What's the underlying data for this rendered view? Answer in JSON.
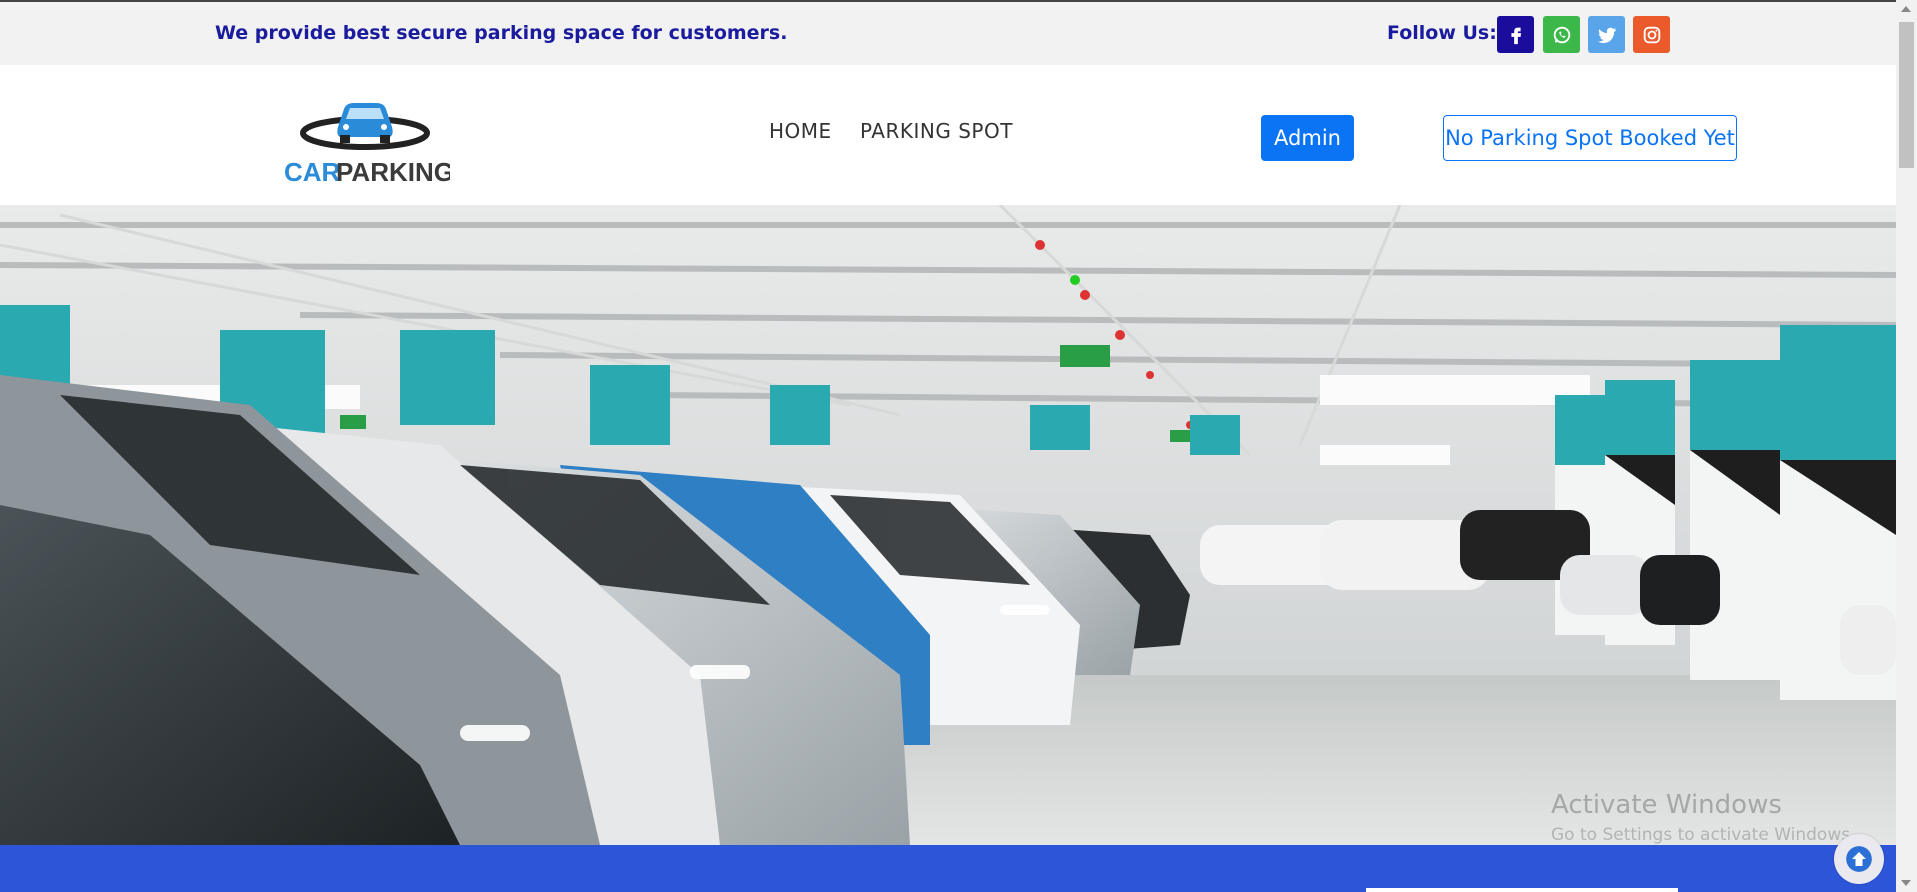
{
  "topbar": {
    "tagline": "We provide best secure parking space for customers.",
    "follow_label": "Follow Us:",
    "social": [
      {
        "icon": "facebook-icon",
        "color": "#1a0d9c"
      },
      {
        "icon": "whatsapp-icon",
        "color": "#3cb84a"
      },
      {
        "icon": "twitter-icon",
        "color": "#5aa5ea"
      },
      {
        "icon": "instagram-icon",
        "color": "#ea5a2a"
      }
    ]
  },
  "logo": {
    "part1": "CAR",
    "part2": "PARKING"
  },
  "nav": {
    "links": [
      "HOME",
      "PARKING SPOT"
    ],
    "admin_label": "Admin",
    "booking_status": "No Parking Spot Booked Yet"
  },
  "watermark": {
    "line1": "Activate Windows",
    "line2": "Go to Settings to activate Windows."
  },
  "colors": {
    "accent": "#0b74f5",
    "band": "#2d55d8",
    "tagline": "#1b1b9e"
  }
}
